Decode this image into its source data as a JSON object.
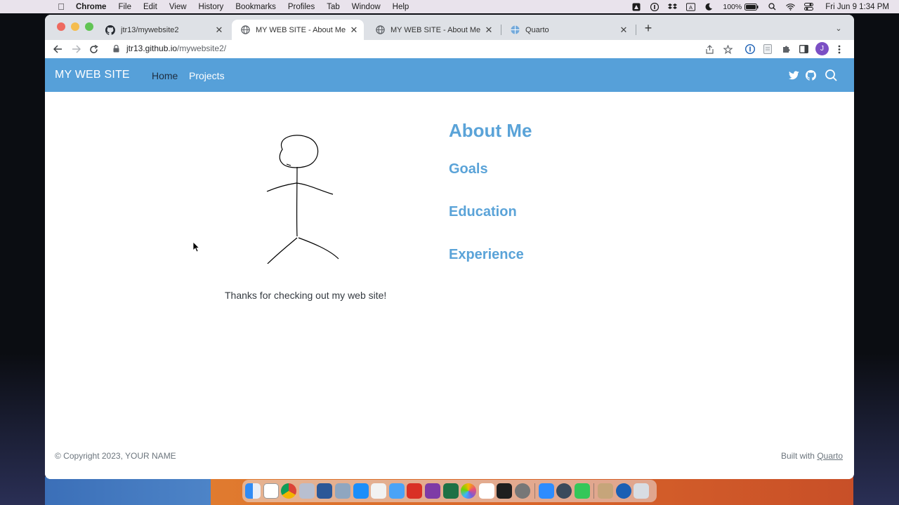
{
  "menubar": {
    "app_name": "Chrome",
    "items": [
      "File",
      "Edit",
      "View",
      "History",
      "Bookmarks",
      "Profiles",
      "Tab",
      "Window",
      "Help"
    ],
    "battery": "100%",
    "clock": "Fri Jun 9  1:34 PM"
  },
  "browser": {
    "tabs": [
      {
        "label": "jtr13/mywebsite2",
        "favicon": "github-icon",
        "active": false
      },
      {
        "label": "MY WEB SITE - About Me",
        "favicon": "globe-icon",
        "active": true
      },
      {
        "label": "MY WEB SITE - About Me",
        "favicon": "globe-icon",
        "active": false
      },
      {
        "label": "Quarto",
        "favicon": "quarto-icon",
        "active": false
      }
    ],
    "url_host": "jtr13.github.io",
    "url_path": "/mywebsite2/",
    "profile_initial": "J"
  },
  "site": {
    "title": "MY WEB SITE",
    "nav": {
      "home": "Home",
      "projects": "Projects"
    },
    "nav_icons": [
      "twitter-icon",
      "github-icon",
      "search-icon"
    ],
    "accent_color": "#56a0d9",
    "heading_color": "#5aa3d8",
    "caption": "Thanks for checking out my web site!",
    "headings": {
      "h1": "About Me",
      "h2": [
        "Goals",
        "Education",
        "Experience"
      ]
    },
    "footer": {
      "copyright": "© Copyright 2023, YOUR NAME",
      "built_prefix": "Built with ",
      "built_link": "Quarto"
    }
  },
  "dock": {
    "icons": [
      "finder-icon",
      "scrivener-icon",
      "chrome-icon",
      "r-icon",
      "word-icon",
      "preview-icon",
      "appstore-icon",
      "pages-icon",
      "mail-icon",
      "acrobat-icon",
      "onenote-icon",
      "excel-icon",
      "photos-icon",
      "grapher-icon",
      "terminal-icon",
      "settings-icon",
      "zoom-icon",
      "quicktime-icon",
      "messages-icon",
      "downloads-icon",
      "1password-icon",
      "trash-icon"
    ]
  }
}
